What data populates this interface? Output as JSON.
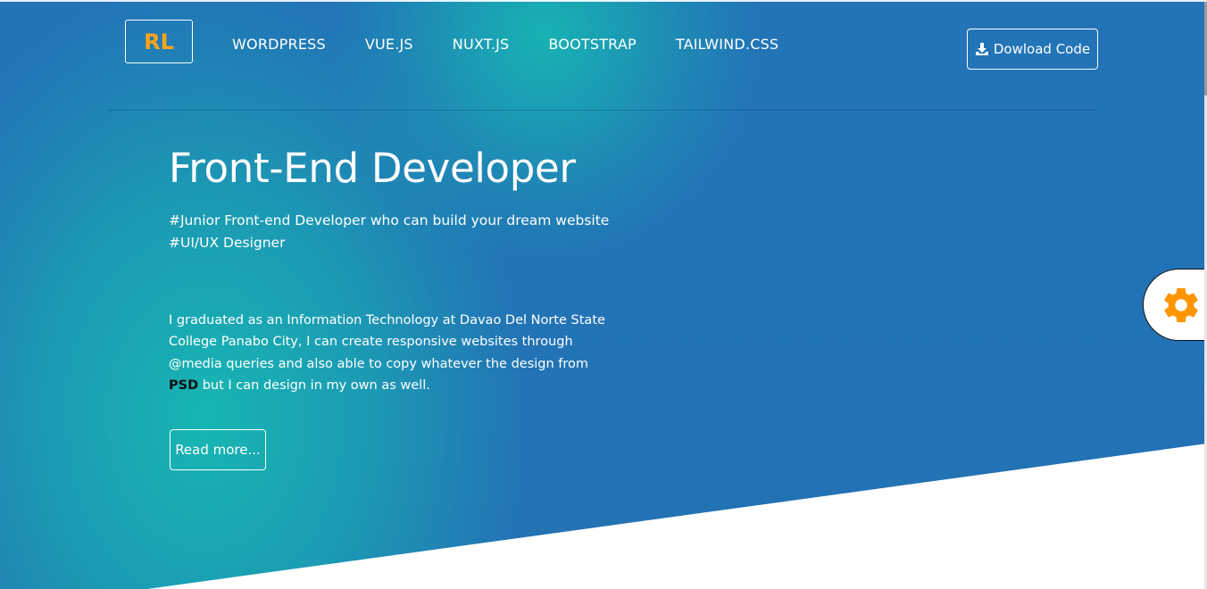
{
  "brand": {
    "logo_text": "RL",
    "logo_color": "#ffa31a"
  },
  "nav": {
    "items": [
      {
        "label": "WORDPRESS"
      },
      {
        "label": "VUE.JS"
      },
      {
        "label": "NUXT.JS"
      },
      {
        "label": "BOOTSTRAP"
      },
      {
        "label": "TAILWIND.CSS"
      }
    ],
    "download_label": "Dowload Code",
    "download_icon": "download-icon"
  },
  "hero": {
    "headline": "Front-End Developer",
    "tagline_1": "#Junior Front-end Developer who can build your dream website",
    "tagline_2": "#UI/UX Designer",
    "about_before": "I graduated as an Information Technology at Davao Del Norte State College Panabo City, I can create responsive websites through @media queries and also able to copy whatever the design from ",
    "about_highlight": "PSD",
    "about_after": " but I can design in my own as well.",
    "read_more_label": "Read more..."
  },
  "settings": {
    "icon": "gear-icon",
    "icon_color": "#ff9500"
  },
  "colors": {
    "primary_blue": "#2274b6",
    "teal": "#16bab2",
    "accent_orange": "#ffa31a"
  }
}
